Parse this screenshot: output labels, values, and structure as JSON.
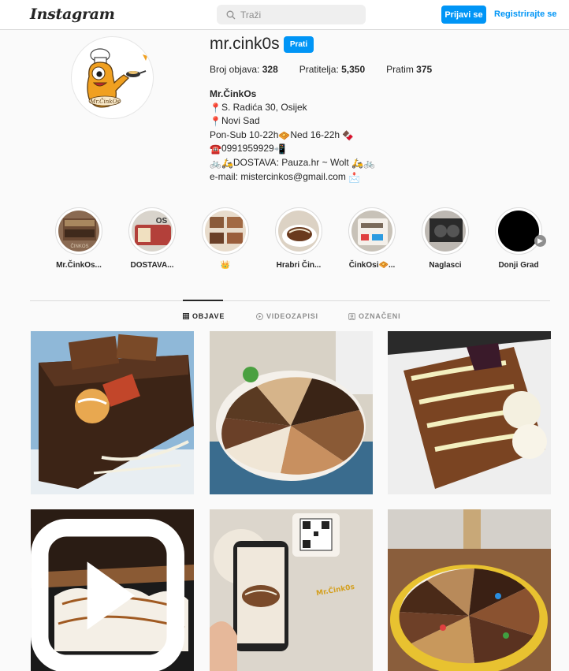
{
  "nav": {
    "logo": "Instagram",
    "search_placeholder": "Traži",
    "login_label": "Prijavi se",
    "register_label": "Registrirajte se",
    "accent": "#0095f6"
  },
  "profile": {
    "username": "mr.cink0s",
    "follow_label": "Prati",
    "stats": {
      "posts_label": "Broj objava:",
      "posts_value": "328",
      "followers_label": "Pratitelja:",
      "followers_value": "5,350",
      "following_label": "Pratim",
      "following_value": "375"
    },
    "bio": {
      "name": "Mr.ČinkOs",
      "line1": "S. Radića 30, Osijek",
      "line2": "Novi Sad",
      "line3a": "Pon-Sub 10-22h",
      "line3b": "Ned 16-22h",
      "line4": "0991959929",
      "line5": "DOSTAVA: Pauza.hr ~ Wolt",
      "line6": "e-mail: mistercinkos@gmail.com"
    }
  },
  "highlights": [
    {
      "label": "Mr.ČinkOs..."
    },
    {
      "label": "DOSTAVA..."
    },
    {
      "label": "👑"
    },
    {
      "label": "Hrabri Čin..."
    },
    {
      "label": "ČinkOsi🧇..."
    },
    {
      "label": "Naglasci"
    },
    {
      "label": "Donji Grad"
    }
  ],
  "tabs": [
    {
      "label": "OBJAVE",
      "icon": "grid-icon"
    },
    {
      "label": "VIDEOZAPISI",
      "icon": "play-circle-icon"
    },
    {
      "label": "OZNAČENI",
      "icon": "tag-icon"
    }
  ]
}
